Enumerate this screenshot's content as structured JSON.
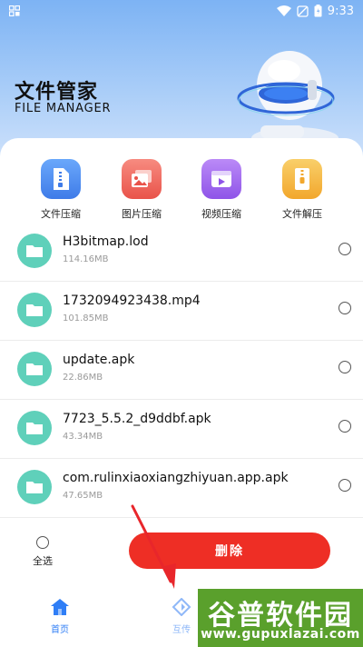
{
  "status_bar": {
    "time": "9:33"
  },
  "header": {
    "title_cn": "文件管家",
    "title_en": "FILE MANAGER"
  },
  "tools": [
    {
      "label": "文件压缩",
      "icon": "zip-file-icon",
      "color": "#4f8ef3"
    },
    {
      "label": "图片压缩",
      "icon": "image-icon",
      "color": "#f06c63"
    },
    {
      "label": "视频压缩",
      "icon": "video-icon",
      "color": "#a56cf0"
    },
    {
      "label": "文件解压",
      "icon": "unzip-file-icon",
      "color": "#f5b63e"
    }
  ],
  "files": [
    {
      "name": "H3bitmap.lod",
      "size": "114.16MB"
    },
    {
      "name": "1732094923438.mp4",
      "size": "101.85MB"
    },
    {
      "name": "update.apk",
      "size": "22.86MB"
    },
    {
      "name": "7723_5.5.2_d9ddbf.apk",
      "size": "43.34MB"
    },
    {
      "name": "com.rulinxiaoxiangzhiyuan.app.apk",
      "size": "47.65MB"
    }
  ],
  "actions": {
    "select_all": "全选",
    "delete": "删除"
  },
  "bottom_nav": [
    {
      "label": "首页",
      "icon": "home-icon",
      "active": true
    },
    {
      "label": "互传",
      "icon": "transfer-icon",
      "active": false
    }
  ],
  "watermark": {
    "title": "谷普软件园",
    "url": "www.gupuxlazai.com"
  },
  "colors": {
    "accent": "#ee2e25",
    "folder": "#5fd0ba",
    "nav_active": "#2f7ef6"
  }
}
